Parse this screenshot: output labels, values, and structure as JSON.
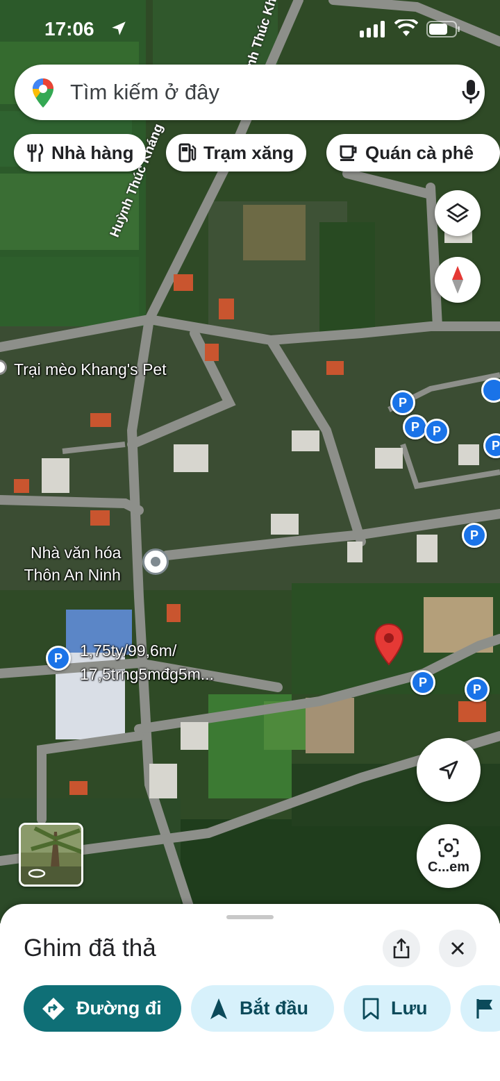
{
  "status_bar": {
    "time": "17:06"
  },
  "search": {
    "placeholder": "Tìm kiếm ở đây"
  },
  "chips": [
    {
      "label": "Nhà hàng",
      "icon": "restaurant-icon"
    },
    {
      "label": "Trạm xăng",
      "icon": "gas-station-icon"
    },
    {
      "label": "Quán cà phê",
      "icon": "coffee-icon"
    }
  ],
  "map": {
    "road_label": "Huỳnh Thúc Kháng",
    "road_label_top": "Huỳnh Thúc Khá",
    "places": [
      {
        "name": "Trại mèo Khang's Pet"
      },
      {
        "name_line1": "Nhà văn hóa",
        "name_line2": "Thôn An Ninh"
      },
      {
        "name_line1": "1,75ty/99,6m/",
        "name_line2": "17,5trng5mđg5m..."
      }
    ],
    "pin_letter": "P",
    "lens_label": "C...em"
  },
  "sheet": {
    "title": "Ghim đã thả",
    "actions": {
      "directions": "Đường đi",
      "start": "Bắt đầu",
      "save": "Lưu"
    }
  },
  "colors": {
    "accent": "#0f6f76",
    "secondary_chip": "#d7f1fb",
    "pin_blue": "#1a73e8",
    "dropped_pin": "#e53935"
  }
}
